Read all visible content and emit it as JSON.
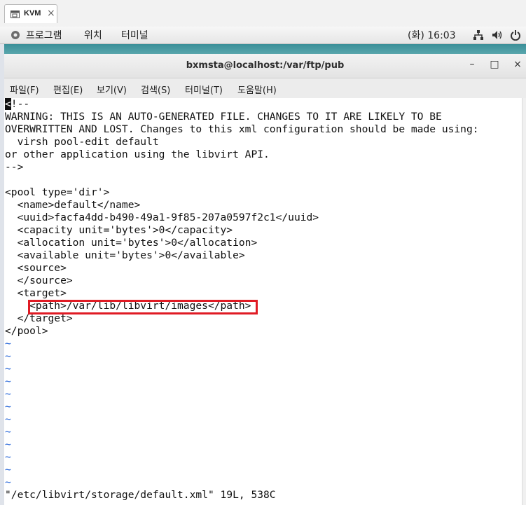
{
  "host_tab": {
    "label": "KVM",
    "close": "×"
  },
  "panel": {
    "menus": [
      "프로그램",
      "위치",
      "터미널"
    ],
    "clock": "(화) 16:03"
  },
  "window": {
    "title": "bxmsta@localhost:/var/ftp/pub",
    "minimize": "–",
    "maximize": "□",
    "close": "×"
  },
  "menubar": [
    "파일(F)",
    "편집(E)",
    "보기(V)",
    "검색(S)",
    "터미널(T)",
    "도움말(H)"
  ],
  "editor": {
    "cursor_char": "<",
    "first_line_rest": "!--",
    "lines": [
      "WARNING: THIS IS AN AUTO-GENERATED FILE. CHANGES TO IT ARE LIKELY TO BE",
      "OVERWRITTEN AND LOST. Changes to this xml configuration should be made using:",
      "  virsh pool-edit default",
      "or other application using the libvirt API.",
      "-->",
      "",
      "<pool type='dir'>",
      "  <name>default</name>",
      "  <uuid>facfa4dd-b490-49a1-9f85-207a0597f2c1</uuid>",
      "  <capacity unit='bytes'>0</capacity>",
      "  <allocation unit='bytes'>0</allocation>",
      "  <available unit='bytes'>0</available>",
      "  <source>",
      "  </source>",
      "  <target>",
      "    <path>/var/lib/libvirt/images</path>",
      "  </target>",
      "</pool>"
    ],
    "tilde": "~",
    "tilde_count": 12,
    "status_line": "\"/etc/libvirt/storage/default.xml\" 19L, 538C"
  },
  "colors": {
    "highlight": "#e01b24",
    "tilde": "#1c5fd7"
  }
}
